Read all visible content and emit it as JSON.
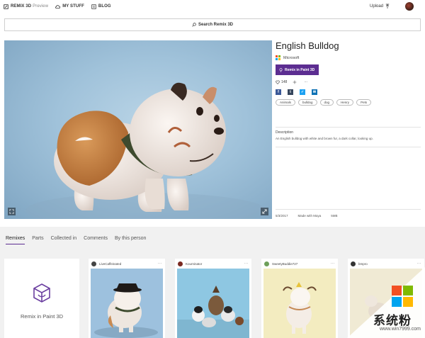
{
  "nav": {
    "brand": "REMIX 3D",
    "preview": "Preview",
    "my_stuff": "MY STUFF",
    "blog": "BLOG",
    "upload": "Upload"
  },
  "search": {
    "label": "Search Remix 3D"
  },
  "model": {
    "title": "English Bulldog",
    "publisher": "Microsoft",
    "remix_button": "Remix in Paint 3D",
    "likes": "148",
    "more": "···",
    "tags": [
      "Animals",
      "bulldog",
      "dog",
      "Henry",
      "Pets"
    ],
    "description_label": "Description",
    "description": "An English bulldog with white and brown fur, a dark collar, looking up.",
    "date": "5/3/2017",
    "made_with": "Made with Maya",
    "size": "5MB"
  },
  "tabs": [
    "Remixes",
    "Parts",
    "Collected in",
    "Comments",
    "By this person"
  ],
  "remix_card": {
    "label": "Remix in Paint 3D"
  },
  "cards": [
    {
      "user": "LiveCaffeinated",
      "more": "···"
    },
    {
      "user": "Kourninator",
      "more": "···"
    },
    {
      "user": "SweetyBuddie727",
      "more": "···"
    },
    {
      "user": "bmpro",
      "more": "···"
    }
  ],
  "watermark": {
    "text": "系统粉",
    "url": "www.win7999.com"
  },
  "colors": {
    "accent": "#5c2d91",
    "hero_bg": "#a0c2da",
    "facebook": "#3b5998",
    "tumblr": "#36465d",
    "twitter": "#1da1f2"
  }
}
